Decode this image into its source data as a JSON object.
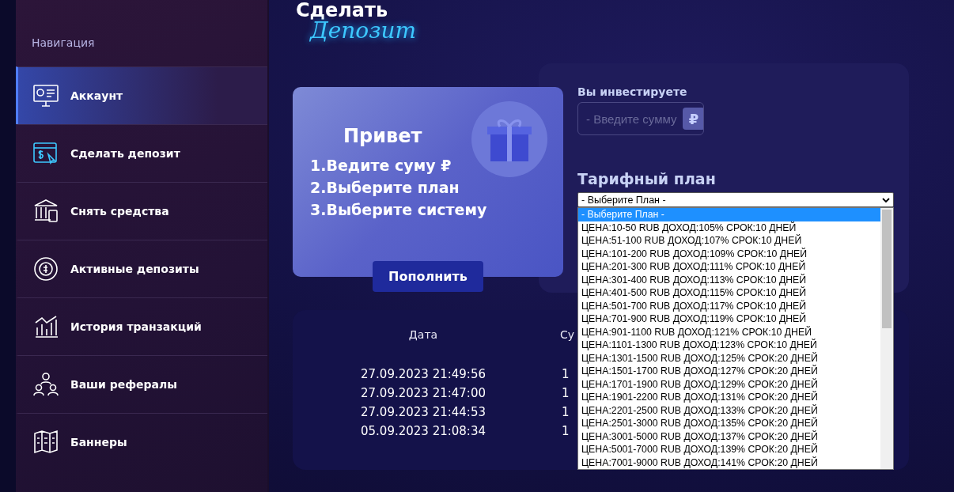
{
  "sidebar": {
    "heading": "Навигация",
    "items": [
      {
        "label": "Аккаунт",
        "selected": true
      },
      {
        "label": "Сделать депозит",
        "selected": false
      },
      {
        "label": "Снять средства",
        "selected": false
      },
      {
        "label": "Активные депозиты",
        "selected": false
      },
      {
        "label": "История транзакций",
        "selected": false
      },
      {
        "label": "Ваши рефералы",
        "selected": false
      },
      {
        "label": "Баннеры",
        "selected": false
      }
    ]
  },
  "page_title": {
    "line_1": "Сделать",
    "line_2": "Депозит"
  },
  "promo_card": {
    "title": "Привет",
    "steps": [
      "1.Ведите суму ₽",
      "2.Выберите план",
      "3.Выберите систему"
    ],
    "button": "Пополнить"
  },
  "invest_form": {
    "label": "Вы инвестируете",
    "amount_placeholder": "- Введите сумму",
    "currency": "₽",
    "plan_label": "Тарифный план",
    "plan_select": {
      "value": "- Выберите План -",
      "expanded": true,
      "options": [
        {
          "label": "- Выберите План -",
          "selected": true
        },
        {
          "label": "ЦЕНА:10-50 RUB ДОХОД:105% СРОК:10 ДНЕЙ",
          "selected": false
        },
        {
          "label": "ЦЕНА:51-100 RUB ДОХОД:107% СРОК:10 ДНЕЙ",
          "selected": false
        },
        {
          "label": "ЦЕНА:101-200 RUB ДОХОД:109% СРОК:10 ДНЕЙ",
          "selected": false
        },
        {
          "label": "ЦЕНА:201-300 RUB ДОХОД:111% СРОК:10 ДНЕЙ",
          "selected": false
        },
        {
          "label": "ЦЕНА:301-400 RUB ДОХОД:113% СРОК:10 ДНЕЙ",
          "selected": false
        },
        {
          "label": "ЦЕНА:401-500 RUB ДОХОД:115% СРОК:10 ДНЕЙ",
          "selected": false
        },
        {
          "label": "ЦЕНА:501-700 RUB ДОХОД:117% СРОК:10 ДНЕЙ",
          "selected": false
        },
        {
          "label": "ЦЕНА:701-900 RUB ДОХОД:119% СРОК:10 ДНЕЙ",
          "selected": false
        },
        {
          "label": "ЦЕНА:901-1100 RUB ДОХОД:121% СРОК:10 ДНЕЙ",
          "selected": false
        },
        {
          "label": "ЦЕНА:1101-1300 RUB ДОХОД:123% СРОК:10 ДНЕЙ",
          "selected": false
        },
        {
          "label": "ЦЕНА:1301-1500 RUB ДОХОД:125% СРОК:20 ДНЕЙ",
          "selected": false
        },
        {
          "label": "ЦЕНА:1501-1700 RUB ДОХОД:127% СРОК:20 ДНЕЙ",
          "selected": false
        },
        {
          "label": "ЦЕНА:1701-1900 RUB ДОХОД:129% СРОК:20 ДНЕЙ",
          "selected": false
        },
        {
          "label": "ЦЕНА:1901-2200 RUB ДОХОД:131% СРОК:20 ДНЕЙ",
          "selected": false
        },
        {
          "label": "ЦЕНА:2201-2500 RUB ДОХОД:133% СРОК:20 ДНЕЙ",
          "selected": false
        },
        {
          "label": "ЦЕНА:2501-3000 RUB ДОХОД:135% СРОК:20 ДНЕЙ",
          "selected": false
        },
        {
          "label": "ЦЕНА:3001-5000 RUB ДОХОД:137% СРОК:20 ДНЕЙ",
          "selected": false
        },
        {
          "label": "ЦЕНА:5001-7000 RUB ДОХОД:139% СРОК:20 ДНЕЙ",
          "selected": false
        },
        {
          "label": "ЦЕНА:7001-9000 RUB ДОХОД:141% СРОК:20 ДНЕЙ",
          "selected": false
        }
      ]
    }
  },
  "history_table": {
    "columns": [
      "Дата",
      "Су"
    ],
    "rows": [
      [
        "27.09.2023 21:49:56",
        "1"
      ],
      [
        "27.09.2023 21:47:00",
        "1"
      ],
      [
        "27.09.2023 21:44:53",
        "1"
      ],
      [
        "05.09.2023 21:08:34",
        "1"
      ]
    ]
  }
}
